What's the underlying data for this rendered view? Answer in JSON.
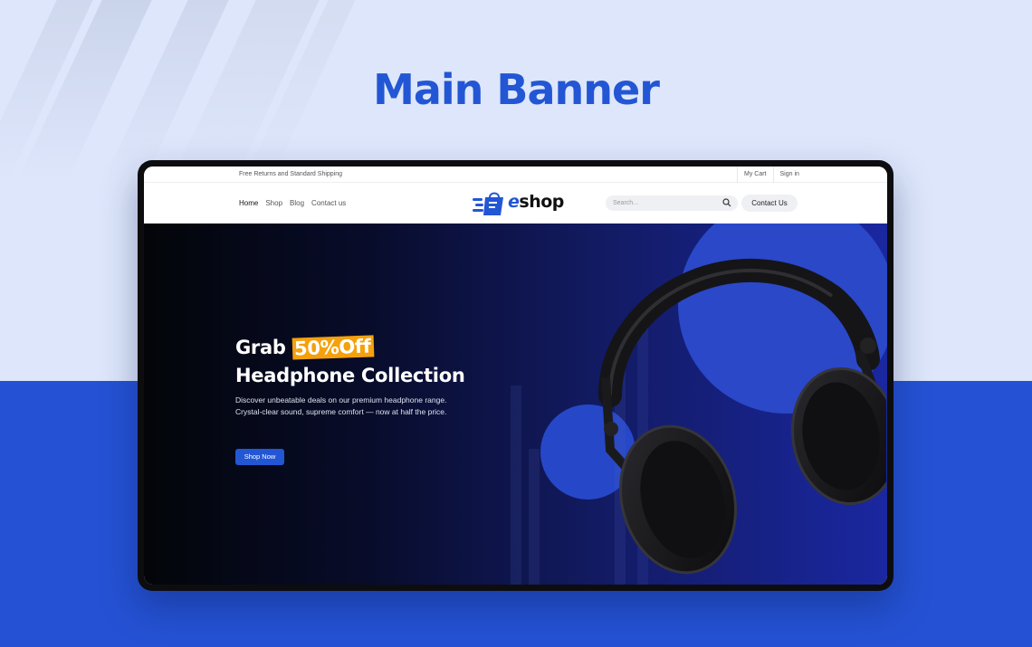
{
  "showcase": {
    "title": "Main Banner"
  },
  "colors": {
    "accent": "#2356d4",
    "highlight": "#f5a10d",
    "page_bg": "#dde6fb",
    "band": "#2552d4"
  },
  "topbar": {
    "shipping_text": "Free Returns and Standard Shipping",
    "cart_label": "My Cart",
    "signin_label": "Sign in"
  },
  "nav": {
    "items": [
      "Home",
      "Shop",
      "Blog",
      "Contact us"
    ],
    "active": "Home",
    "logo_text_e": "e",
    "logo_text_rest": "shop",
    "search_placeholder": "Search...",
    "search_icon": "search-icon",
    "contact_button": "Contact Us"
  },
  "hero": {
    "line1_prefix": "Grab ",
    "highlight": "50%Off",
    "line2": "Headphone Collection",
    "desc_line1": "Discover unbeatable deals on our premium headphone range.",
    "desc_line2": "Crystal-clear sound, supreme comfort — now at half the price.",
    "cta": "Shop Now"
  }
}
